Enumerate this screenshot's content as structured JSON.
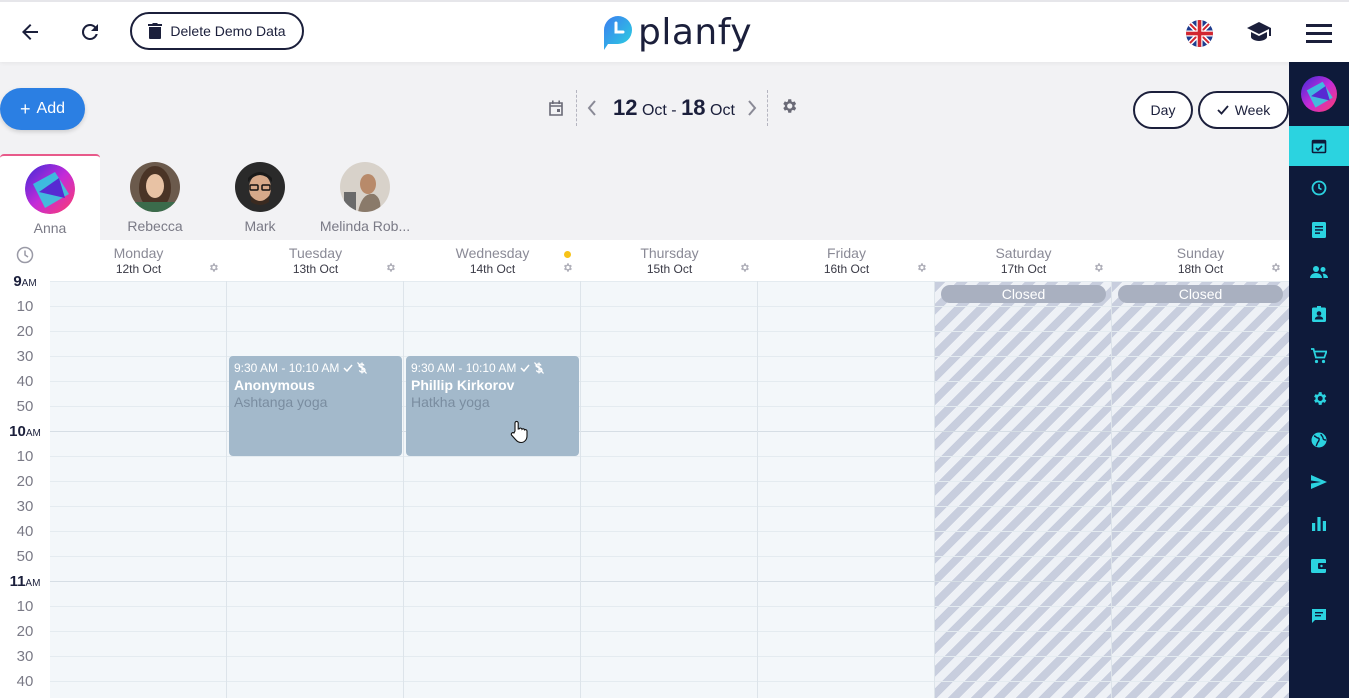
{
  "topbar": {
    "delete_demo_label": "Delete Demo Data",
    "logo_text": "planfy"
  },
  "toolbar": {
    "add_label": "Add",
    "range_start_day": "12",
    "range_start_month": "Oct",
    "range_sep": "-",
    "range_end_day": "18",
    "range_end_month": "Oct",
    "day_label": "Day",
    "week_label": "Week"
  },
  "staff": [
    {
      "name": "Anna",
      "active": true
    },
    {
      "name": "Rebecca",
      "active": false
    },
    {
      "name": "Mark",
      "active": false
    },
    {
      "name": "Melinda Rob...",
      "active": false
    }
  ],
  "days": [
    {
      "name": "Monday",
      "date": "12th Oct"
    },
    {
      "name": "Tuesday",
      "date": "13th Oct"
    },
    {
      "name": "Wednesday",
      "date": "14th Oct"
    },
    {
      "name": "Thursday",
      "date": "15th Oct"
    },
    {
      "name": "Friday",
      "date": "16th Oct"
    },
    {
      "name": "Saturday",
      "date": "17th Oct"
    },
    {
      "name": "Sunday",
      "date": "18th Oct"
    }
  ],
  "closed_label": "Closed",
  "time_labels": {
    "h9": "9",
    "h10": "10",
    "h11": "11",
    "am": "AM",
    "minutes": [
      "10",
      "20",
      "30",
      "40",
      "50"
    ]
  },
  "events": [
    {
      "time": "9:30 AM - 10:10 AM",
      "client": "Anonymous",
      "service": "Ashtanga yoga"
    },
    {
      "time": "9:30 AM - 10:10 AM",
      "client": "Phillip Kirkorov",
      "service": "Hatkha yoga"
    }
  ],
  "colors": {
    "accent": "#2b7fe3",
    "sidebar": "#0e1a3a",
    "sidebar_active": "#2bd3e0",
    "event": "#a3b9cb",
    "navy": "#1b1f3b"
  }
}
